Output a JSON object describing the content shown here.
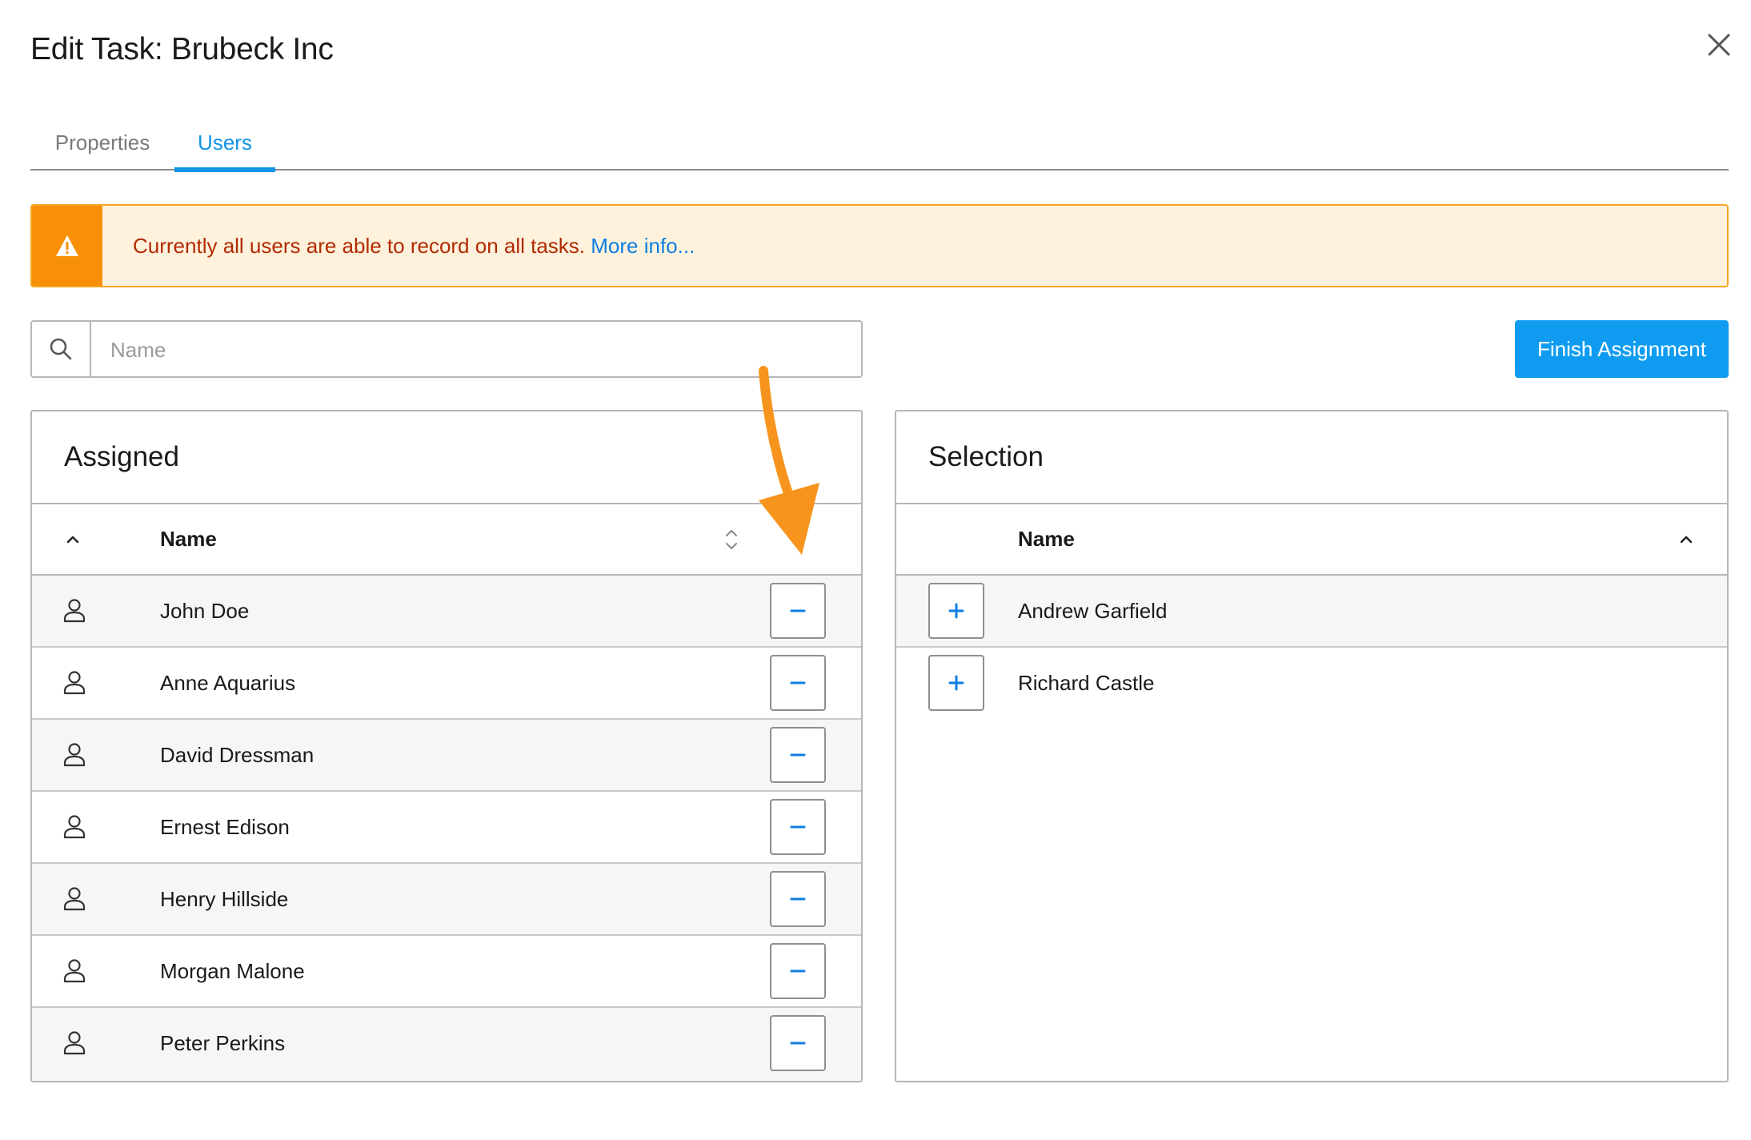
{
  "dialog": {
    "title": "Edit Task: Brubeck Inc"
  },
  "tabs": [
    {
      "label": "Properties",
      "active": false
    },
    {
      "label": "Users",
      "active": true
    }
  ],
  "alert": {
    "message": "Currently all users are able to record on all tasks.",
    "link": "More info...",
    "icon": "warning-icon"
  },
  "search": {
    "placeholder": "Name",
    "value": ""
  },
  "finish_button": {
    "label": "Finish Assignment"
  },
  "assigned": {
    "title": "Assigned",
    "column_name": "Name",
    "rows": [
      {
        "name": "John Doe"
      },
      {
        "name": "Anne Aquarius"
      },
      {
        "name": "David Dressman"
      },
      {
        "name": "Ernest Edison"
      },
      {
        "name": "Henry Hillside"
      },
      {
        "name": "Morgan Malone"
      },
      {
        "name": "Peter Perkins"
      }
    ]
  },
  "selection": {
    "title": "Selection",
    "column_name": "Name",
    "rows": [
      {
        "name": "Andrew Garfield"
      },
      {
        "name": "Richard Castle"
      }
    ]
  },
  "colors": {
    "accent": "#0f94e6",
    "warning": "#f79007",
    "warning_text": "#b22a00",
    "annotation_arrow": "#f7941d"
  }
}
